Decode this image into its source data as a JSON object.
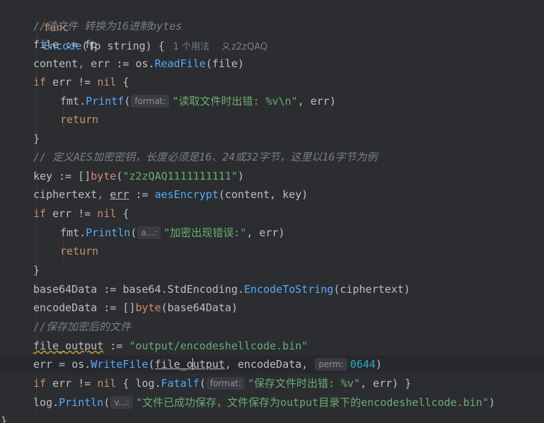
{
  "header": {
    "func_kw": "func",
    "func_name": "Encode",
    "params": "(fp string) {",
    "usages": "1 个用法",
    "author": "z2zQAQ"
  },
  "lines": {
    "l2_comment": "//读文件 转换为16进制bytes",
    "l3_var": "file",
    "l3_op": " := ",
    "l3_val": "fp",
    "l4_content": "content",
    "l4_comma": ", ",
    "l4_err": "err",
    "l4_op": " := ",
    "l4_pkg": "os",
    "l4_dot": ".",
    "l4_fn": "ReadFile",
    "l4_args": "(file)",
    "l5_if": "if",
    "l5_cond": " err != ",
    "l5_nil": "nil",
    "l5_brace": " {",
    "l6_pkg": "fmt",
    "l6_dot": ".",
    "l6_fn": "Printf",
    "l6_open": "(",
    "l6_hint": "format:",
    "l6_str": "\"读取文件时出错: %v\\n\"",
    "l6_rest": ", err)",
    "l7_return": "return",
    "l8_close": "}",
    "l9_comment": "// 定义AES加密密钥，长度必须是16、24或32字节，这里以16字节为例",
    "l10_key": "key",
    "l10_op": " := []",
    "l10_type": "byte",
    "l10_open": "(",
    "l10_str": "\"z2zQAQ1111111111\"",
    "l10_close": ")",
    "l11_cipher": "ciphertext",
    "l11_comma": ", ",
    "l11_err": "err",
    "l11_op": " := ",
    "l11_fn": "aesEncrypt",
    "l11_args": "(content, key)",
    "l12_if": "if",
    "l12_cond": " err != ",
    "l12_nil": "nil",
    "l12_brace": " {",
    "l13_pkg": "fmt",
    "l13_dot": ".",
    "l13_fn": "Println",
    "l13_open": "(",
    "l13_hint": "a...:",
    "l13_str": "\"加密出现错误:\"",
    "l13_rest": ", err)",
    "l14_return": "return",
    "l15_close": "}",
    "l16_var": "base64Data",
    "l16_op": " := ",
    "l16_pkg": "base64",
    "l16_dot1": ".",
    "l16_mid": "StdEncoding",
    "l16_dot2": ".",
    "l16_fn": "EncodeToString",
    "l16_args": "(ciphertext)",
    "l17_var": "encodeData",
    "l17_op": " := []",
    "l17_type": "byte",
    "l17_args": "(base64Data)",
    "l18_comment": "//保存加密后的文件",
    "l19_var": "file_output",
    "l19_op": " := ",
    "l19_str": "\"output/encodeshellcode.bin\"",
    "l20_err": "err",
    "l20_op": " = ",
    "l20_pkg": "os",
    "l20_dot": ".",
    "l20_fn": "WriteFile",
    "l20_open": "(",
    "l20_arg1a": "file_o",
    "l20_arg1b": "utput",
    "l20_mid": ", encodeData, ",
    "l20_hint": "perm:",
    "l20_num": "0644",
    "l20_close": ")",
    "l21_if": "if",
    "l21_cond": " err != ",
    "l21_nil": "nil",
    "l21_brace": " { ",
    "l21_pkg": "log",
    "l21_dot": ".",
    "l21_fn": "Fatalf",
    "l21_open": "(",
    "l21_hint": "format:",
    "l21_str": "\"保存文件时出错: %v\"",
    "l21_rest": ", err)",
    "l21_close": " }",
    "l22_pkg": "log",
    "l22_dot": ".",
    "l22_fn": "Println",
    "l22_open": "(",
    "l22_hint": "v...:",
    "l22_str": "\"文件已成功保存，文件保存为output目录下的encodeshellcode.bin\"",
    "l22_close": ")",
    "l23_close": "}"
  }
}
